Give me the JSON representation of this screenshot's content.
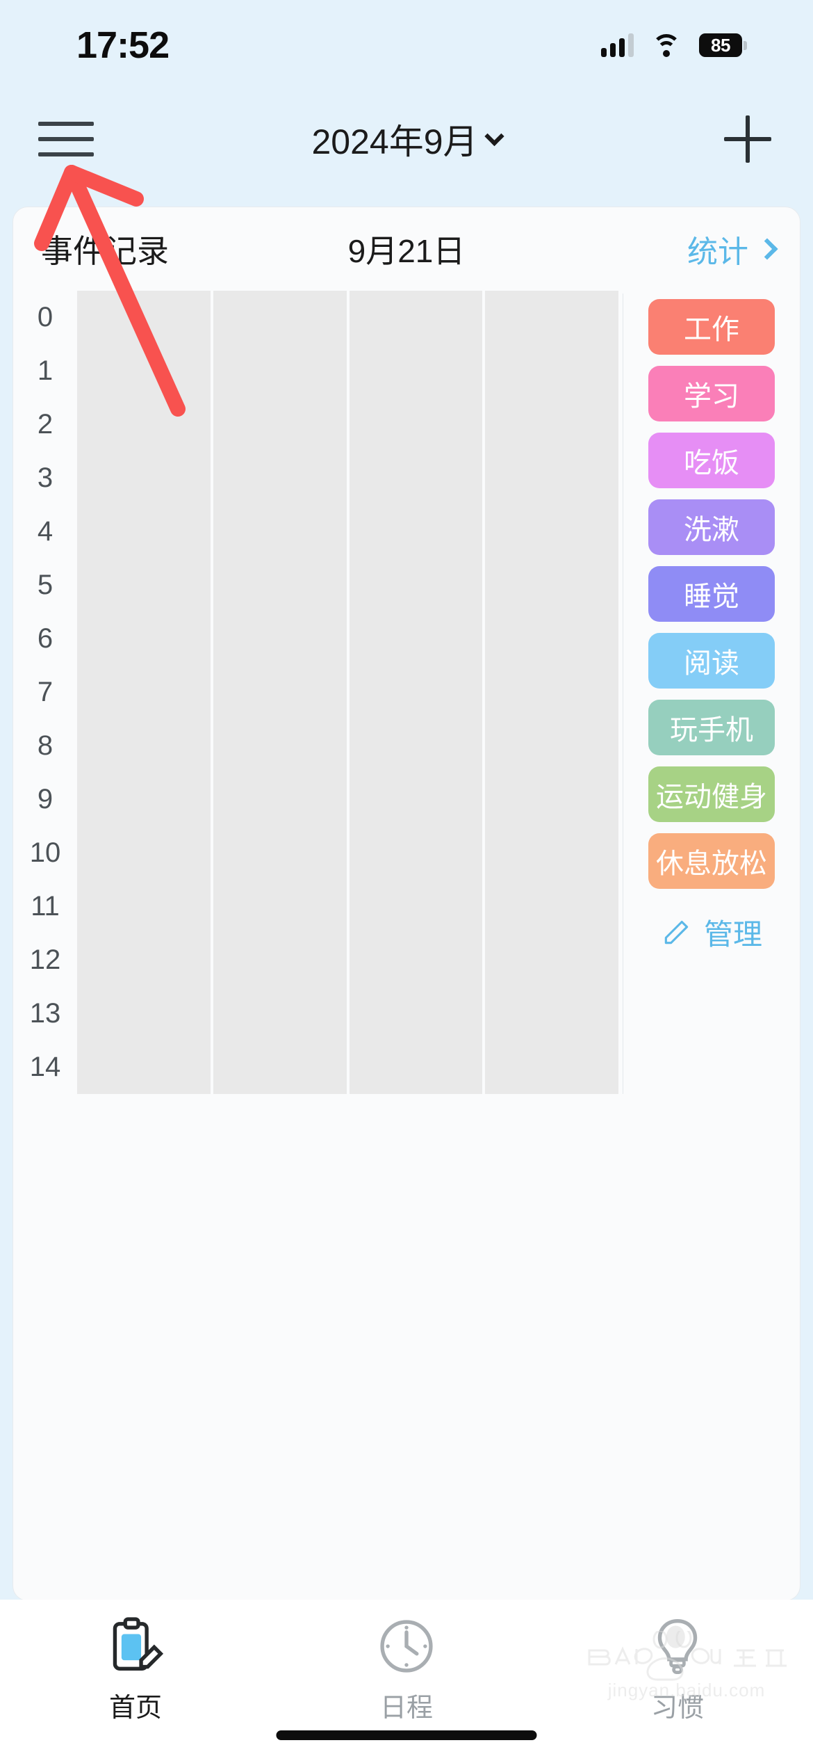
{
  "status_bar": {
    "time": "17:52",
    "signal_icon": "signal-bars-icon",
    "wifi_icon": "wifi-icon",
    "battery_level": "85"
  },
  "nav_bar": {
    "menu_icon": "hamburger-menu-icon",
    "title": "2024年9月",
    "dropdown_icon": "chevron-down-icon",
    "add_icon": "plus-icon"
  },
  "card": {
    "title": "事件记录",
    "date": "9月21日",
    "stats_label": "统计",
    "stats_chevron_icon": "chevron-right-icon"
  },
  "timeline": {
    "hours": [
      "0",
      "1",
      "2",
      "3",
      "4",
      "5",
      "6",
      "7",
      "8",
      "9",
      "10",
      "11",
      "12",
      "13",
      "14"
    ],
    "columns_per_hour": 4,
    "cell_color": "#e9e9e9"
  },
  "categories": [
    {
      "label": "工作",
      "color": "#fa8072"
    },
    {
      "label": "学习",
      "color": "#fa7fb8"
    },
    {
      "label": "吃饭",
      "color": "#e68ef5"
    },
    {
      "label": "洗漱",
      "color": "#a98ef5"
    },
    {
      "label": "睡觉",
      "color": "#8f8cf5"
    },
    {
      "label": "阅读",
      "color": "#84cdf7"
    },
    {
      "label": "玩手机",
      "color": "#96cfbe"
    },
    {
      "label": "运动健身",
      "color": "#a7d285"
    },
    {
      "label": "休息放松",
      "color": "#f9ad7e"
    }
  ],
  "manage": {
    "label": "管理",
    "icon": "pencil-icon",
    "color": "#5bb8e8"
  },
  "annotation": {
    "type": "arrow",
    "color": "#f8524f",
    "points_to": "hamburger-menu-icon"
  },
  "tab_bar": {
    "tabs": [
      {
        "label": "首页",
        "icon": "clipboard-pen-icon",
        "active": true
      },
      {
        "label": "日程",
        "icon": "clock-icon",
        "active": false
      },
      {
        "label": "习惯",
        "icon": "lightbulb-icon",
        "active": false
      }
    ]
  },
  "watermark": {
    "brand": "Baidu 经验",
    "url": "jingyan.baidu.com"
  }
}
